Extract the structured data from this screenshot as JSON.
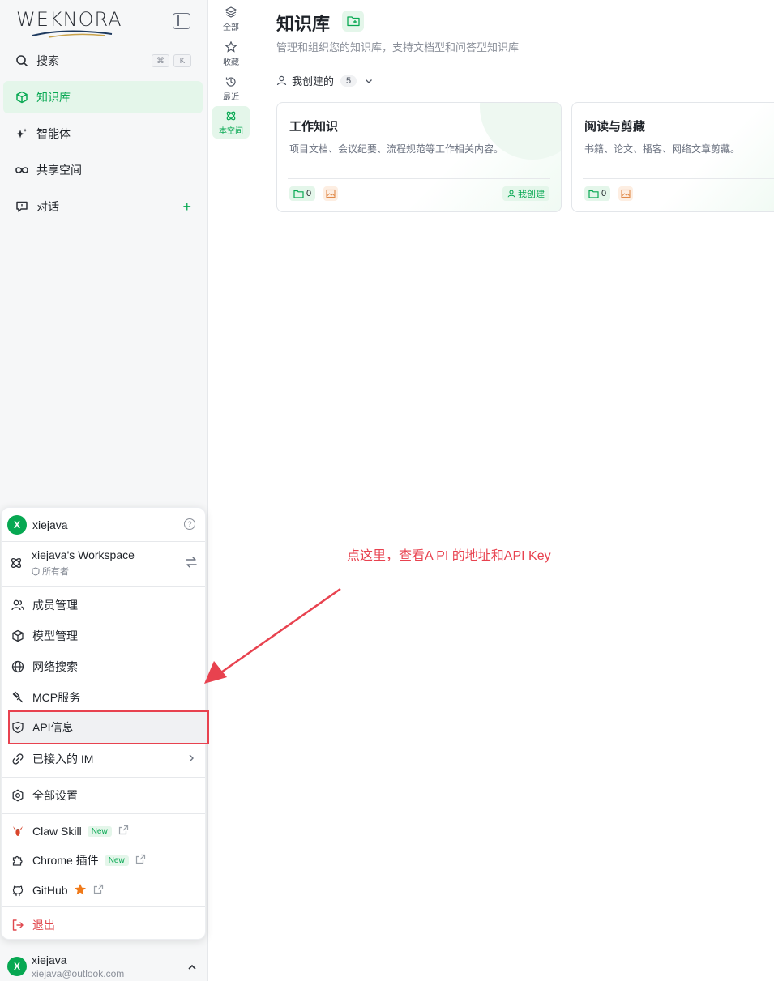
{
  "app": {
    "logo_text": "WEKNORA"
  },
  "sidebar": {
    "search_label": "搜索",
    "shortcut": [
      "⌘",
      "K"
    ],
    "items": [
      {
        "label": "知识库",
        "icon": "cube-icon",
        "active": true
      },
      {
        "label": "智能体",
        "icon": "sparkle-icon",
        "active": false
      },
      {
        "label": "共享空间",
        "icon": "infinity-icon",
        "active": false
      },
      {
        "label": "对话",
        "icon": "chat-icon",
        "active": false
      }
    ],
    "add_label": "+"
  },
  "subnav": [
    {
      "label": "全部",
      "icon": "layers-icon"
    },
    {
      "label": "收藏",
      "icon": "star-icon"
    },
    {
      "label": "最近",
      "icon": "history-icon"
    },
    {
      "label": "本空间",
      "icon": "atom-icon",
      "active": true
    }
  ],
  "main": {
    "title": "知识库",
    "subtitle": "管理和组织您的知识库，支持文档型和问答型知识库",
    "filter_label": "我创建的",
    "filter_count": "5"
  },
  "cards": [
    {
      "title": "工作知识",
      "desc": "项目文档、会议纪要、流程规范等工作相关内容。",
      "doc_count": "0",
      "owner": "我创建"
    },
    {
      "title": "阅读与剪藏",
      "desc": "书籍、论文、播客、网络文章剪藏。",
      "doc_count": "0"
    }
  ],
  "popup": {
    "user": {
      "initial": "X",
      "name": "xiejava",
      "help": "?"
    },
    "workspace": {
      "name": "xiejava's Workspace",
      "role": "所有者"
    },
    "menu": [
      {
        "label": "成员管理",
        "icon": "users-icon"
      },
      {
        "label": "模型管理",
        "icon": "box-icon"
      },
      {
        "label": "网络搜索",
        "icon": "globe-icon"
      },
      {
        "label": "MCP服务",
        "icon": "plug-icon"
      },
      {
        "label": "API信息",
        "icon": "shield-icon",
        "highlighted": true
      },
      {
        "label": "已接入的 IM",
        "icon": "link-icon"
      }
    ],
    "settings_label": "全部设置",
    "extras": [
      {
        "label": "Claw Skill",
        "badge": "New",
        "icon": "lobster-icon"
      },
      {
        "label": "Chrome 插件",
        "badge": "New",
        "icon": "puzzle-icon"
      },
      {
        "label": "GitHub",
        "icon": "github-icon"
      }
    ],
    "logout_label": "退出"
  },
  "account": {
    "initial": "X",
    "name": "xiejava",
    "email": "xiejava@outlook.com"
  },
  "annotation": {
    "text": "点这里，查看A PI 的地址和API Key"
  },
  "colors": {
    "accent": "#07a852",
    "annotation": "#e8424f",
    "highlight_border": "#e8424f"
  }
}
